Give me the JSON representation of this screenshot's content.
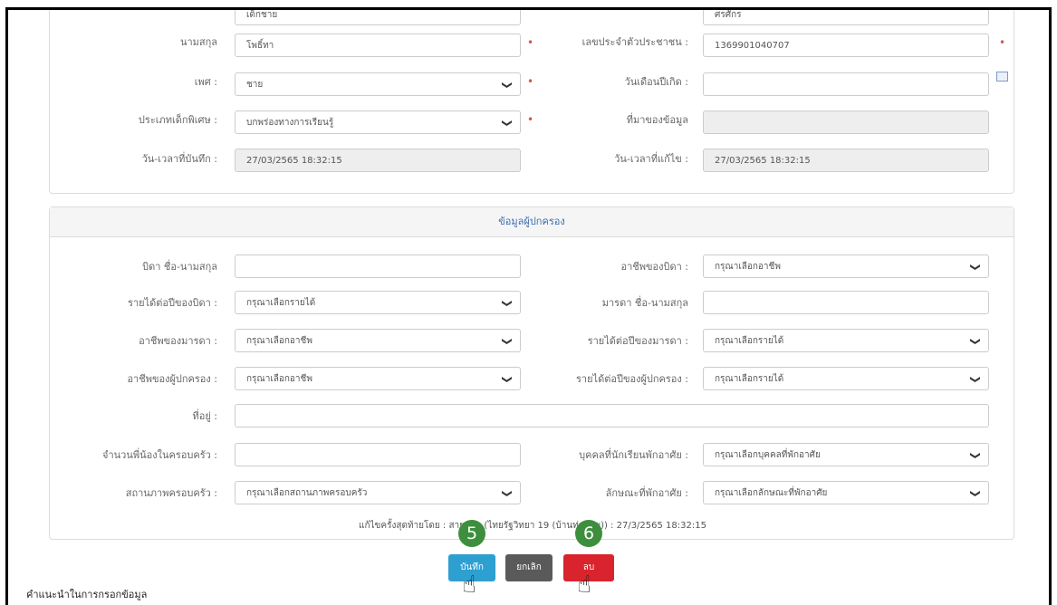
{
  "student": {
    "top_left_value": "เด็กชาย",
    "top_right_value": "ศรศักร",
    "lastname_label": "นามสกุล",
    "lastname_value": "โพธิ์ทา",
    "citizen_id_label": "เลขประจำตัวประชาชน :",
    "citizen_id_value": "1369901040707",
    "gender_label": "เพศ :",
    "gender_value": "ชาย",
    "birthdate_label": "วันเดือนปีเกิด :",
    "birthdate_value": "",
    "special_type_label": "ประเภทเด็กพิเศษ :",
    "special_type_value": "บกพร่องทางการเรียนรู้",
    "source_label": "ที่มาของข้อมูล",
    "source_value": "",
    "created_label": "วัน-เวลาที่บันทึก :",
    "created_value": "27/03/2565 18:32:15",
    "edited_label": "วัน-เวลาที่แก้ไข :",
    "edited_value": "27/03/2565 18:32:15"
  },
  "guardian": {
    "header": "ข้อมูลผู้ปกครอง",
    "father_name_label": "บิดา ชื่อ-นามสกุล",
    "father_job_label": "อาชีพของบิดา :",
    "father_job_value": "กรุณาเลือกอาชีพ",
    "father_income_label": "รายได้ต่อปีของบิดา :",
    "father_income_value": "กรุณาเลือกรายได้",
    "mother_name_label": "มารดา ชื่อ-นามสกุล",
    "mother_job_label": "อาชีพของมารดา :",
    "mother_job_value": "กรุณาเลือกอาชีพ",
    "mother_income_label": "รายได้ต่อปีของมารดา :",
    "mother_income_value": "กรุณาเลือกรายได้",
    "guardian_job_label": "อาชีพของผู้ปกครอง :",
    "guardian_job_value": "กรุณาเลือกอาชีพ",
    "guardian_income_label": "รายได้ต่อปีของผู้ปกครอง :",
    "guardian_income_value": "กรุณาเลือกรายได้",
    "address_label": "ที่อยู่ :",
    "siblings_label": "จำนวนพี่น้องในครอบครัว :",
    "boarding_person_label": "บุคคลที่นักเรียนพักอาศัย :",
    "boarding_person_value": "กรุณาเลือกบุคคลที่พักอาศัย",
    "family_status_label": "สถานภาพครอบครัว :",
    "family_status_value": "กรุณาเลือกสถานภาพครอบครัว",
    "residence_label": "ลักษณะที่พักอาศัย :",
    "residence_value": "กรุณาเลือกลักษณะที่พักอาศัย",
    "last_edit": "แก้ไขครั้งสุดท้ายโดย : สายสุดา (ไทยรัฐวิทยา 19 (บ้านท่าน้อย)) : 27/3/2565 18:32:15"
  },
  "actions": {
    "save_label": "บันทึก",
    "cancel_label": "ยกเลิก",
    "delete_label": "ลบ",
    "step_save": "5",
    "step_delete": "6"
  },
  "footer": {
    "instructions_title": "คำแนะนำในการกรอกข้อมูล"
  },
  "colors": {
    "save": "#2e9fd1",
    "cancel": "#5a5a5a",
    "delete": "#d9232d",
    "badge": "#3d8f3e",
    "required": "#d9534f"
  },
  "icons": {
    "select_arrow": "chevron-down-icon",
    "calendar": "calendar-icon",
    "cursor": "hand-pointer-icon"
  }
}
